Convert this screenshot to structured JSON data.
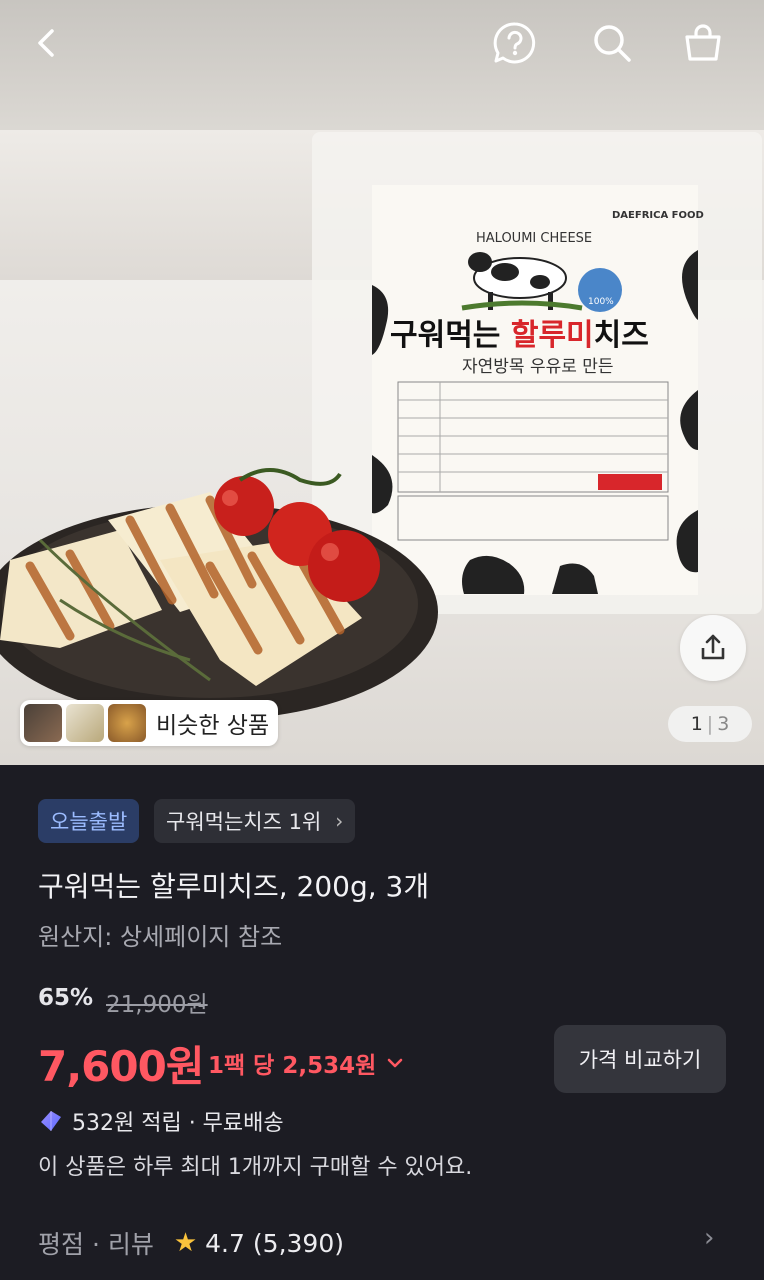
{
  "header": {
    "back_icon": "chevron-left-icon",
    "help_icon": "question-bubble-icon",
    "search_icon": "search-icon",
    "cart_icon": "shopping-bag-icon"
  },
  "image": {
    "similar_label": "비슷한 상품",
    "pager_current": "1",
    "pager_total": "3",
    "package": {
      "subtitle": "HALOUMI CHEESE",
      "brand": "DAEFRICA FOOD",
      "name_black": "구워먹는 ",
      "name_red": "할루미",
      "name_black2": "치즈",
      "tagline": "자연방목 우유로 만든",
      "badge": "100%"
    }
  },
  "badges": {
    "delivery": "오늘출발",
    "ranking": "구워먹는치즈 1위",
    "ranking_chevron": "›"
  },
  "product": {
    "title": "구워먹는 할루미치즈, 200g, 3개",
    "origin": "원산지: 상세페이지 참조"
  },
  "pricing": {
    "discount": "65%",
    "original_price": "21,900원",
    "price": "7,600원",
    "unit_price": "1팩 당 2,534원",
    "compare_button": "가격 비교하기"
  },
  "benefits": {
    "points": "532원 적립 · 무료배송",
    "purchase_limit": "이 상품은 하루 최대 1개까지 구매할 수 있어요."
  },
  "rating": {
    "label": "평점 · 리뷰",
    "score": "4.7",
    "count": "(5,390)"
  },
  "colors": {
    "accent_red": "#ff5862",
    "background": "#1c1c23",
    "chip_blue_bg": "#2b3d66",
    "chip_blue_text": "#9cbcff",
    "star": "#f9c23c"
  }
}
